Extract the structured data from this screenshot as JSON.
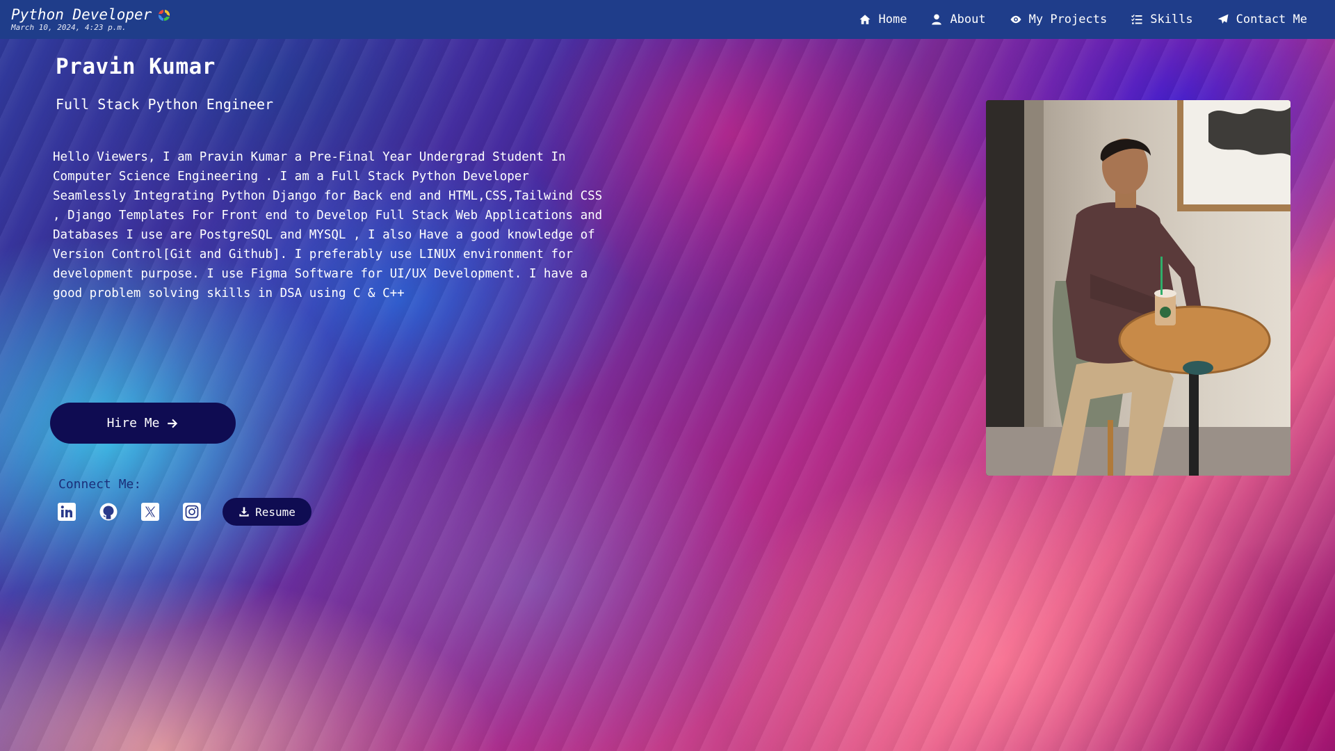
{
  "navbar": {
    "brand_title": "Python Developer",
    "brand_date": "March 10, 2024, 4:23 p.m.",
    "brand_icon": "python-logo-icon",
    "items": [
      {
        "label": "Home",
        "icon": "home-icon"
      },
      {
        "label": "About",
        "icon": "user-icon"
      },
      {
        "label": "My Projects",
        "icon": "eye-icon"
      },
      {
        "label": "Skills",
        "icon": "list-check-icon"
      },
      {
        "label": "Contact Me",
        "icon": "paper-plane-icon"
      }
    ]
  },
  "hero": {
    "name": "Pravin Kumar",
    "role": "Full Stack Python Engineer",
    "bio": "Hello Viewers, I am Pravin Kumar a Pre-Final Year Undergrad Student In Computer Science Engineering . I am a Full Stack Python Developer Seamlessly Integrating Python Django for Back end and HTML,CSS,Tailwind CSS , Django Templates For Front end to Develop Full Stack Web Applications and Databases I use are PostgreSQL and MYSQL , I also Have a good knowledge of Version Control[Git and Github]. I preferably use LINUX environment for development purpose. I use Figma Software for UI/UX Development. I have a good problem solving skills in DSA using C & C++",
    "hire_label": "Hire Me",
    "connect_label": "Connect Me:",
    "resume_label": "Resume",
    "socials": [
      "linkedin-icon",
      "github-icon",
      "x-twitter-icon",
      "instagram-icon"
    ]
  },
  "colors": {
    "navbar_bg": "#1f3d8a",
    "button_bg": "#0f0c52",
    "connect_text": "#1b2f7a"
  }
}
